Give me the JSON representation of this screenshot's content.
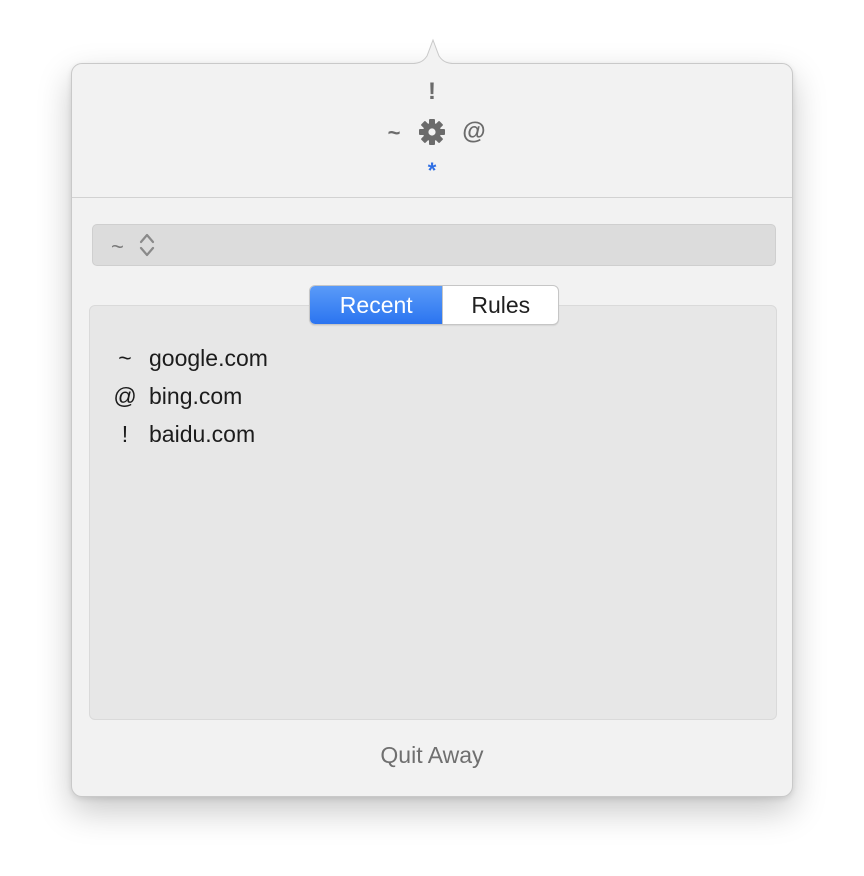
{
  "header": {
    "mode_top": "!",
    "mode_left": "~",
    "mode_right": "@",
    "mode_bottom": "*",
    "center_icon": "gear-icon"
  },
  "selector": {
    "value": "~",
    "icon": "up-down-chevron-icon"
  },
  "tabs": [
    {
      "label": "Recent",
      "selected": true
    },
    {
      "label": "Rules",
      "selected": false
    }
  ],
  "recent_items": [
    {
      "mode": "~",
      "domain": "google.com"
    },
    {
      "mode": "@",
      "domain": "bing.com"
    },
    {
      "mode": "!",
      "domain": "baidu.com"
    }
  ],
  "footer": {
    "quit_label": "Quit Away"
  },
  "colors": {
    "accent": "#2b74f0",
    "asterisk": "#2f6fe4",
    "panel": "#f2f2f2"
  }
}
